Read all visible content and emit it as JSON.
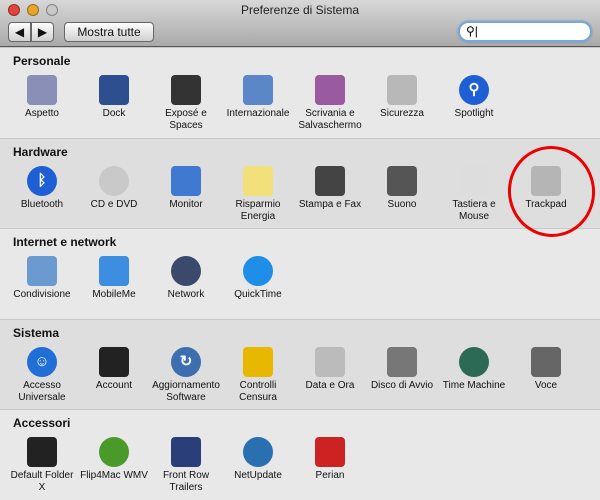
{
  "window": {
    "title": "Preferenze di Sistema",
    "show_all": "Mostra tutte",
    "back": "◀",
    "forward": "▶",
    "search_placeholder": "",
    "search_value": ""
  },
  "sections": [
    {
      "title": "Personale",
      "items": [
        {
          "label": "Aspetto",
          "icon": "appearance-icon",
          "color": "#8a8fb8"
        },
        {
          "label": "Dock",
          "icon": "dock-icon",
          "color": "#2d4f8f"
        },
        {
          "label": "Exposé e Spaces",
          "icon": "expose-icon",
          "color": "#333333"
        },
        {
          "label": "Internazionale",
          "icon": "international-flag-icon",
          "color": "#5b86c7"
        },
        {
          "label": "Scrivania e Salvaschermo",
          "icon": "desktop-icon",
          "color": "#9a5aa0"
        },
        {
          "label": "Sicurezza",
          "icon": "security-house-icon",
          "color": "#b8b8b8"
        },
        {
          "label": "Spotlight",
          "icon": "spotlight-icon",
          "color": "#1f5fd6"
        }
      ]
    },
    {
      "title": "Hardware",
      "items": [
        {
          "label": "Bluetooth",
          "icon": "bluetooth-icon",
          "color": "#1f5fd6"
        },
        {
          "label": "CD e DVD",
          "icon": "cd-icon",
          "color": "#c9c9c9"
        },
        {
          "label": "Monitor",
          "icon": "monitor-icon",
          "color": "#3f7ad0"
        },
        {
          "label": "Risparmio Energia",
          "icon": "lightbulb-icon",
          "color": "#f2e07a"
        },
        {
          "label": "Stampa e Fax",
          "icon": "printer-icon",
          "color": "#444444"
        },
        {
          "label": "Suono",
          "icon": "speaker-icon",
          "color": "#555555"
        },
        {
          "label": "Tastiera e Mouse",
          "icon": "keyboard-mouse-icon",
          "color": "#dddddd"
        },
        {
          "label": "Trackpad",
          "icon": "trackpad-icon",
          "color": "#b5b5b5"
        }
      ]
    },
    {
      "title": "Internet e network",
      "items": [
        {
          "label": "Condivisione",
          "icon": "sharing-folder-icon",
          "color": "#6b9ad0"
        },
        {
          "label": "MobileMe",
          "icon": "mobileme-cloud-icon",
          "color": "#3d8ee0"
        },
        {
          "label": "Network",
          "icon": "network-globe-icon",
          "color": "#3b4a6b"
        },
        {
          "label": "QuickTime",
          "icon": "quicktime-icon",
          "color": "#1f8ee8"
        }
      ]
    },
    {
      "title": "Sistema",
      "items": [
        {
          "label": "Accesso Universale",
          "icon": "accessibility-icon",
          "color": "#1f6fd6"
        },
        {
          "label": "Account",
          "icon": "accounts-icon",
          "color": "#222222"
        },
        {
          "label": "Aggiornamento Software",
          "icon": "software-update-icon",
          "color": "#3c6fb0"
        },
        {
          "label": "Controlli Censura",
          "icon": "parental-controls-icon",
          "color": "#e8b800"
        },
        {
          "label": "Data e Ora",
          "icon": "date-time-icon",
          "color": "#bbbbbb"
        },
        {
          "label": "Disco di Avvio",
          "icon": "startup-disk-icon",
          "color": "#777777"
        },
        {
          "label": "Time Machine",
          "icon": "time-machine-icon",
          "color": "#2d6a55"
        },
        {
          "label": "Voce",
          "icon": "microphone-icon",
          "color": "#666666"
        }
      ]
    },
    {
      "title": "Accessori",
      "items": [
        {
          "label": "Default Folder X",
          "icon": "default-folder-icon",
          "color": "#222222"
        },
        {
          "label": "Flip4Mac WMV",
          "icon": "flip4mac-icon",
          "color": "#4a9a2a"
        },
        {
          "label": "Front Row Trailers",
          "icon": "front-row-icon",
          "color": "#2a3f7a"
        },
        {
          "label": "NetUpdate",
          "icon": "netupdate-icon",
          "color": "#2a6fb0"
        },
        {
          "label": "Perian",
          "icon": "perian-knife-icon",
          "color": "#cc2222"
        }
      ]
    }
  ],
  "icon_glyphs": {
    "Spotlight": "⚲",
    "Bluetooth": "ᛒ",
    "Aggiornamento Software": "↻",
    "Accesso Universale": "☺"
  }
}
